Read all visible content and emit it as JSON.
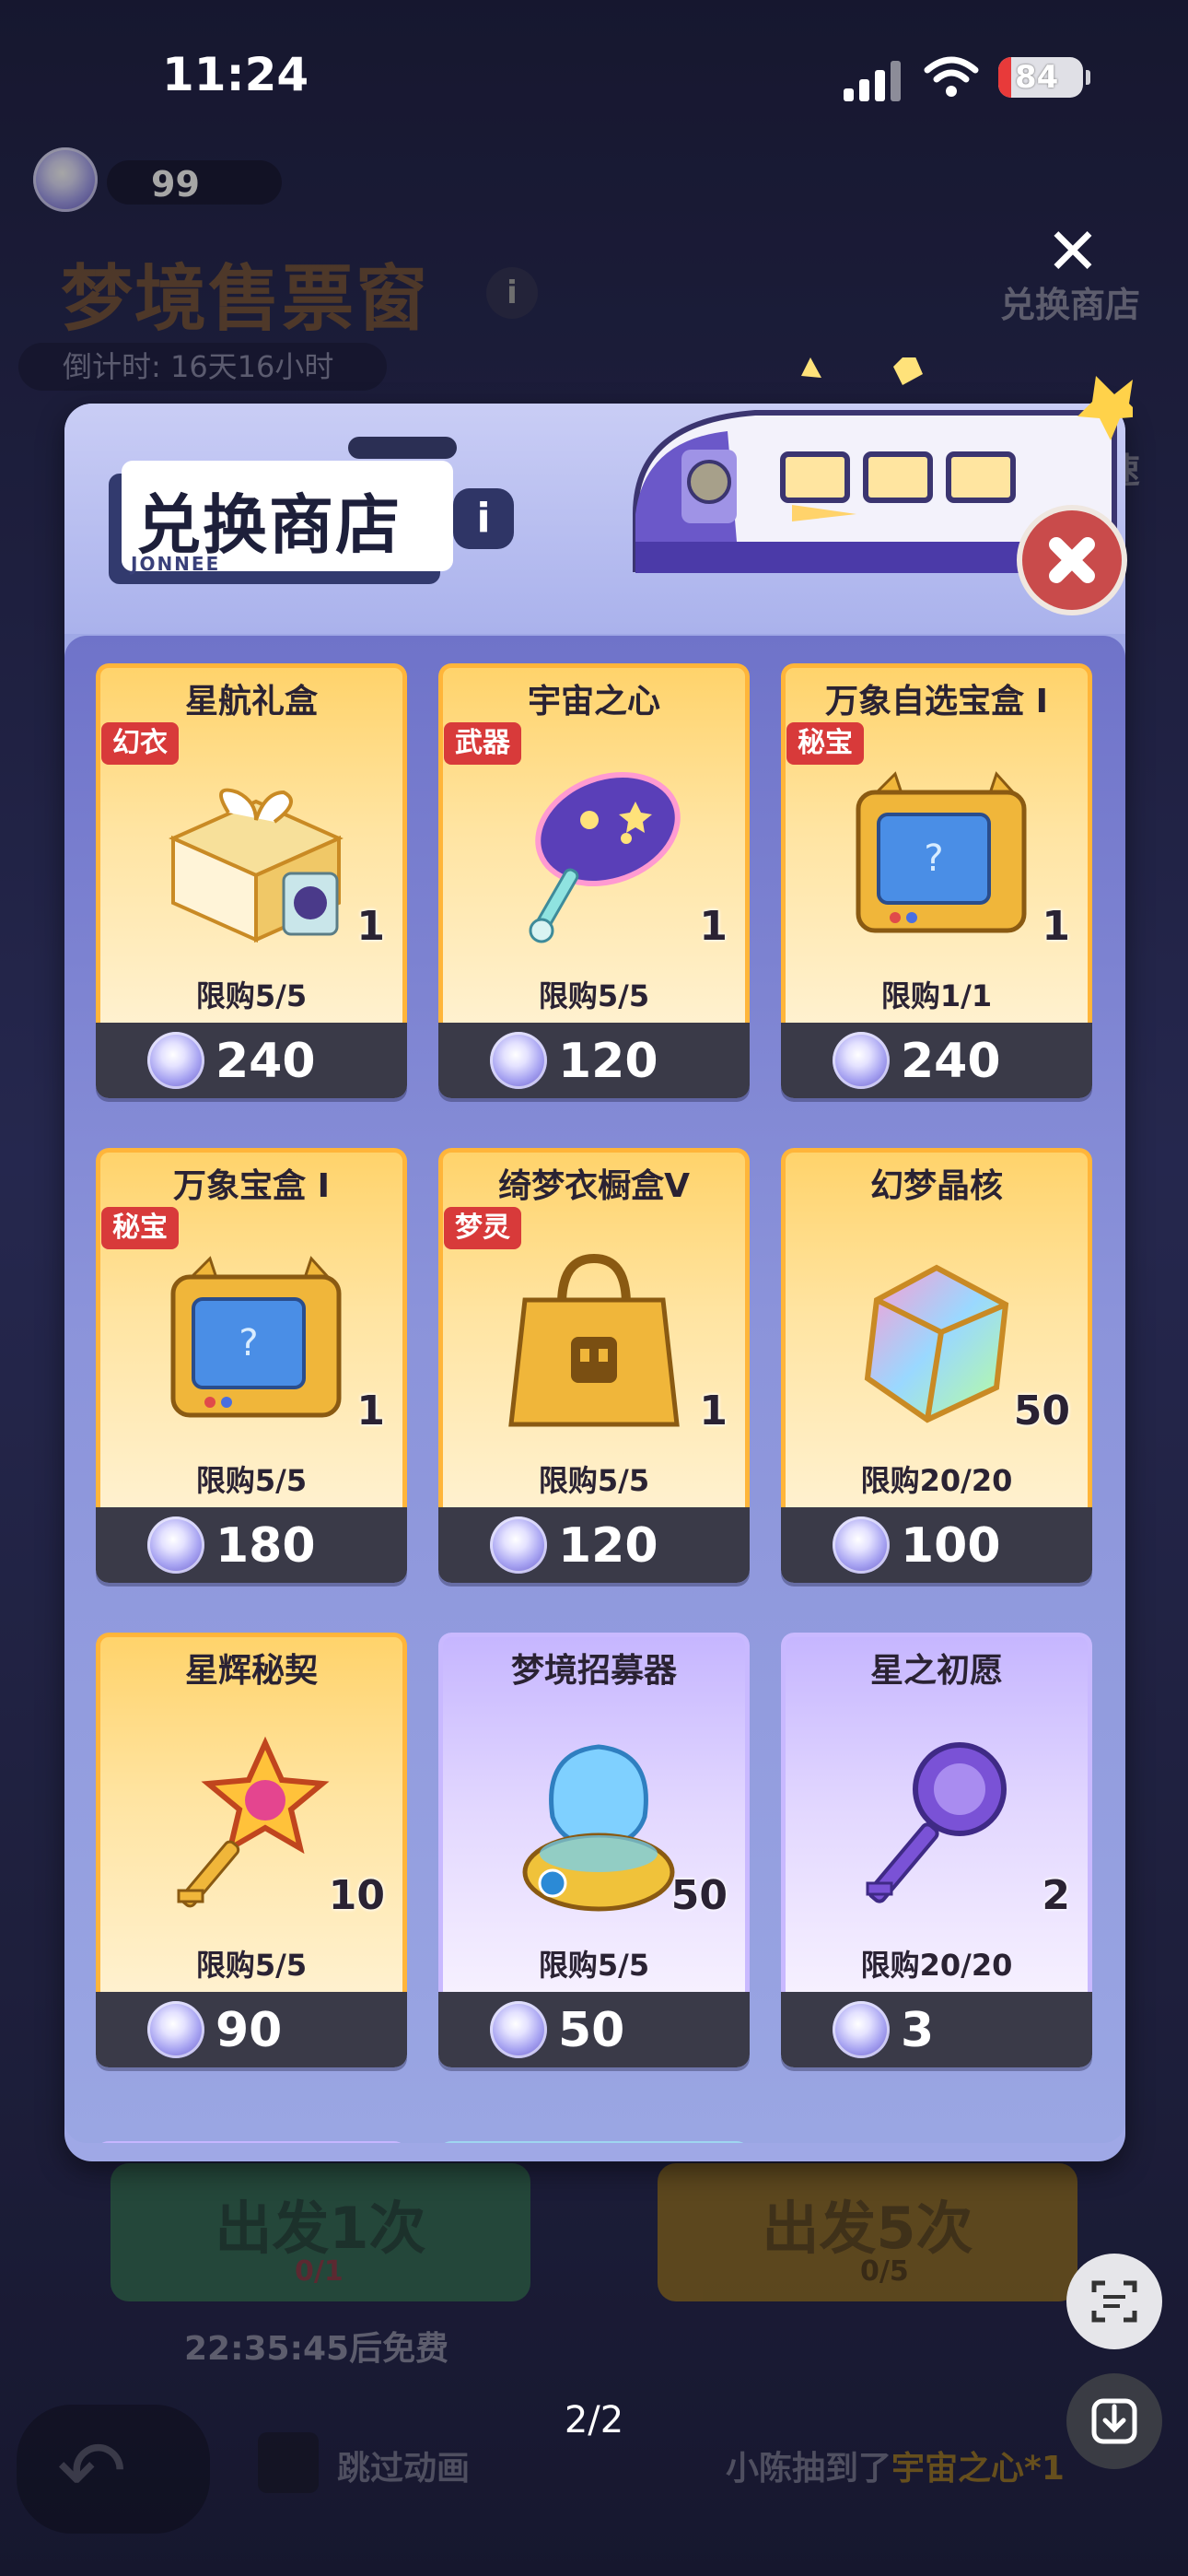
{
  "status_bar": {
    "time": "11:24",
    "battery": "84"
  },
  "background": {
    "coin_count": "99",
    "title": "梦境售票窗",
    "countdown": "倒计时: 16天16小时",
    "exchange_label": "兑换商店",
    "speed_label": "速",
    "depart_one": "出发1次",
    "depart_one_tickets": "0/1",
    "depart_five": "出发5次",
    "depart_five_tickets": "0/5",
    "free_timer": "22:35:45后免费",
    "skip_animation": "跳过动画",
    "ticker_prefix": "小陈抽到了",
    "ticker_item": "宇宙之心*1"
  },
  "modal": {
    "title": "兑换商店",
    "brand": "JONNEE",
    "items": [
      {
        "name": "星航礼盒",
        "tag": "幻衣",
        "qty": "1",
        "limit": "限购5/5",
        "price": "240",
        "style": "gold",
        "icon": "gift-box-icon"
      },
      {
        "name": "宇宙之心",
        "tag": "武器",
        "qty": "1",
        "limit": "限购5/5",
        "price": "120",
        "style": "gold",
        "icon": "cosmic-fan-icon"
      },
      {
        "name": "万象自选宝盒 I",
        "tag": "秘宝",
        "qty": "1",
        "limit": "限购1/1",
        "price": "240",
        "style": "gold",
        "icon": "tv-box-icon"
      },
      {
        "name": "万象宝盒 I",
        "tag": "秘宝",
        "qty": "1",
        "limit": "限购5/5",
        "price": "180",
        "style": "gold",
        "icon": "tv-box-icon"
      },
      {
        "name": "绮梦衣橱盒V",
        "tag": "梦灵",
        "qty": "1",
        "limit": "限购5/5",
        "price": "120",
        "style": "gold",
        "icon": "shopping-bag-icon"
      },
      {
        "name": "幻梦晶核",
        "tag": "",
        "qty": "50",
        "limit": "限购20/20",
        "price": "100",
        "style": "gold",
        "icon": "crystal-core-icon"
      },
      {
        "name": "星辉秘契",
        "tag": "",
        "qty": "10",
        "limit": "限购5/5",
        "price": "90",
        "style": "gold",
        "icon": "star-key-icon"
      },
      {
        "name": "梦境招募器",
        "tag": "",
        "qty": "50",
        "limit": "限购5/5",
        "price": "50",
        "style": "purple",
        "icon": "recruiter-icon"
      },
      {
        "name": "星之初愿",
        "tag": "",
        "qty": "2",
        "limit": "限购20/20",
        "price": "3",
        "style": "purple",
        "icon": "purple-key-icon"
      }
    ]
  },
  "viewer": {
    "page_indicator": "2/2"
  }
}
